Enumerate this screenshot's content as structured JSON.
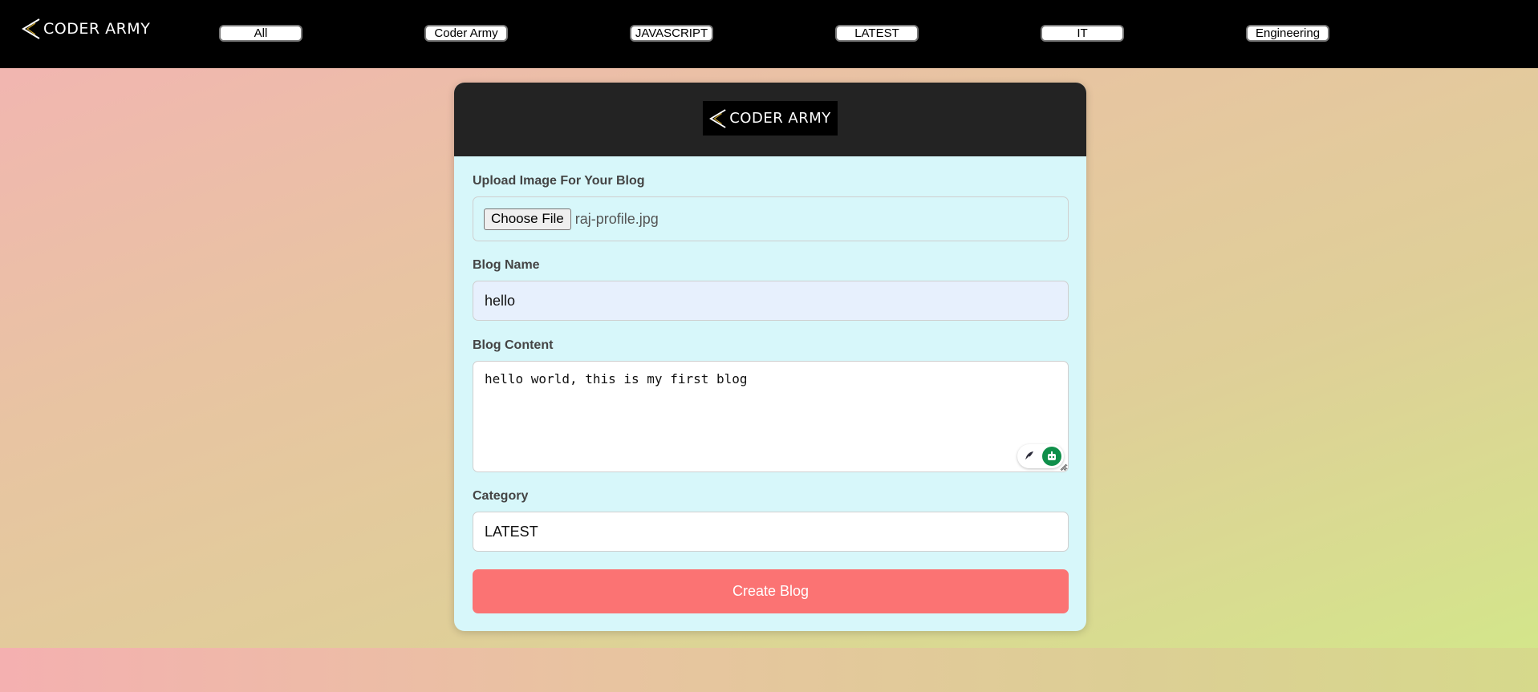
{
  "brand": {
    "name": "CODER ARMY"
  },
  "nav": {
    "items": [
      {
        "label": "All"
      },
      {
        "label": "Coder Army"
      },
      {
        "label": "JAVASCRIPT"
      },
      {
        "label": "LATEST"
      },
      {
        "label": "IT"
      },
      {
        "label": "Engineering"
      }
    ]
  },
  "form": {
    "logo_text": "CODER ARMY",
    "upload_label": "Upload Image For Your Blog",
    "choose_file_label": "Choose File",
    "file_name": "raj-profile.jpg",
    "name_label": "Blog Name",
    "name_value": "hello",
    "content_label": "Blog Content",
    "content_value": "hello world, this is my first blog",
    "category_label": "Category",
    "category_value": "LATEST",
    "submit_label": "Create Blog"
  },
  "colors": {
    "topbar": "#000000",
    "card_header": "#232323",
    "card_body": "#d7f7fa",
    "name_input_bg": "#e7f0fd",
    "submit_button": "#fb7373",
    "extension_bot": "#0f8f4a"
  },
  "icons": {
    "brand_logo": "chevron-left-triangle-icon",
    "feather": "feather-icon",
    "bot": "bot-icon",
    "resize": "resize-handle-icon"
  }
}
